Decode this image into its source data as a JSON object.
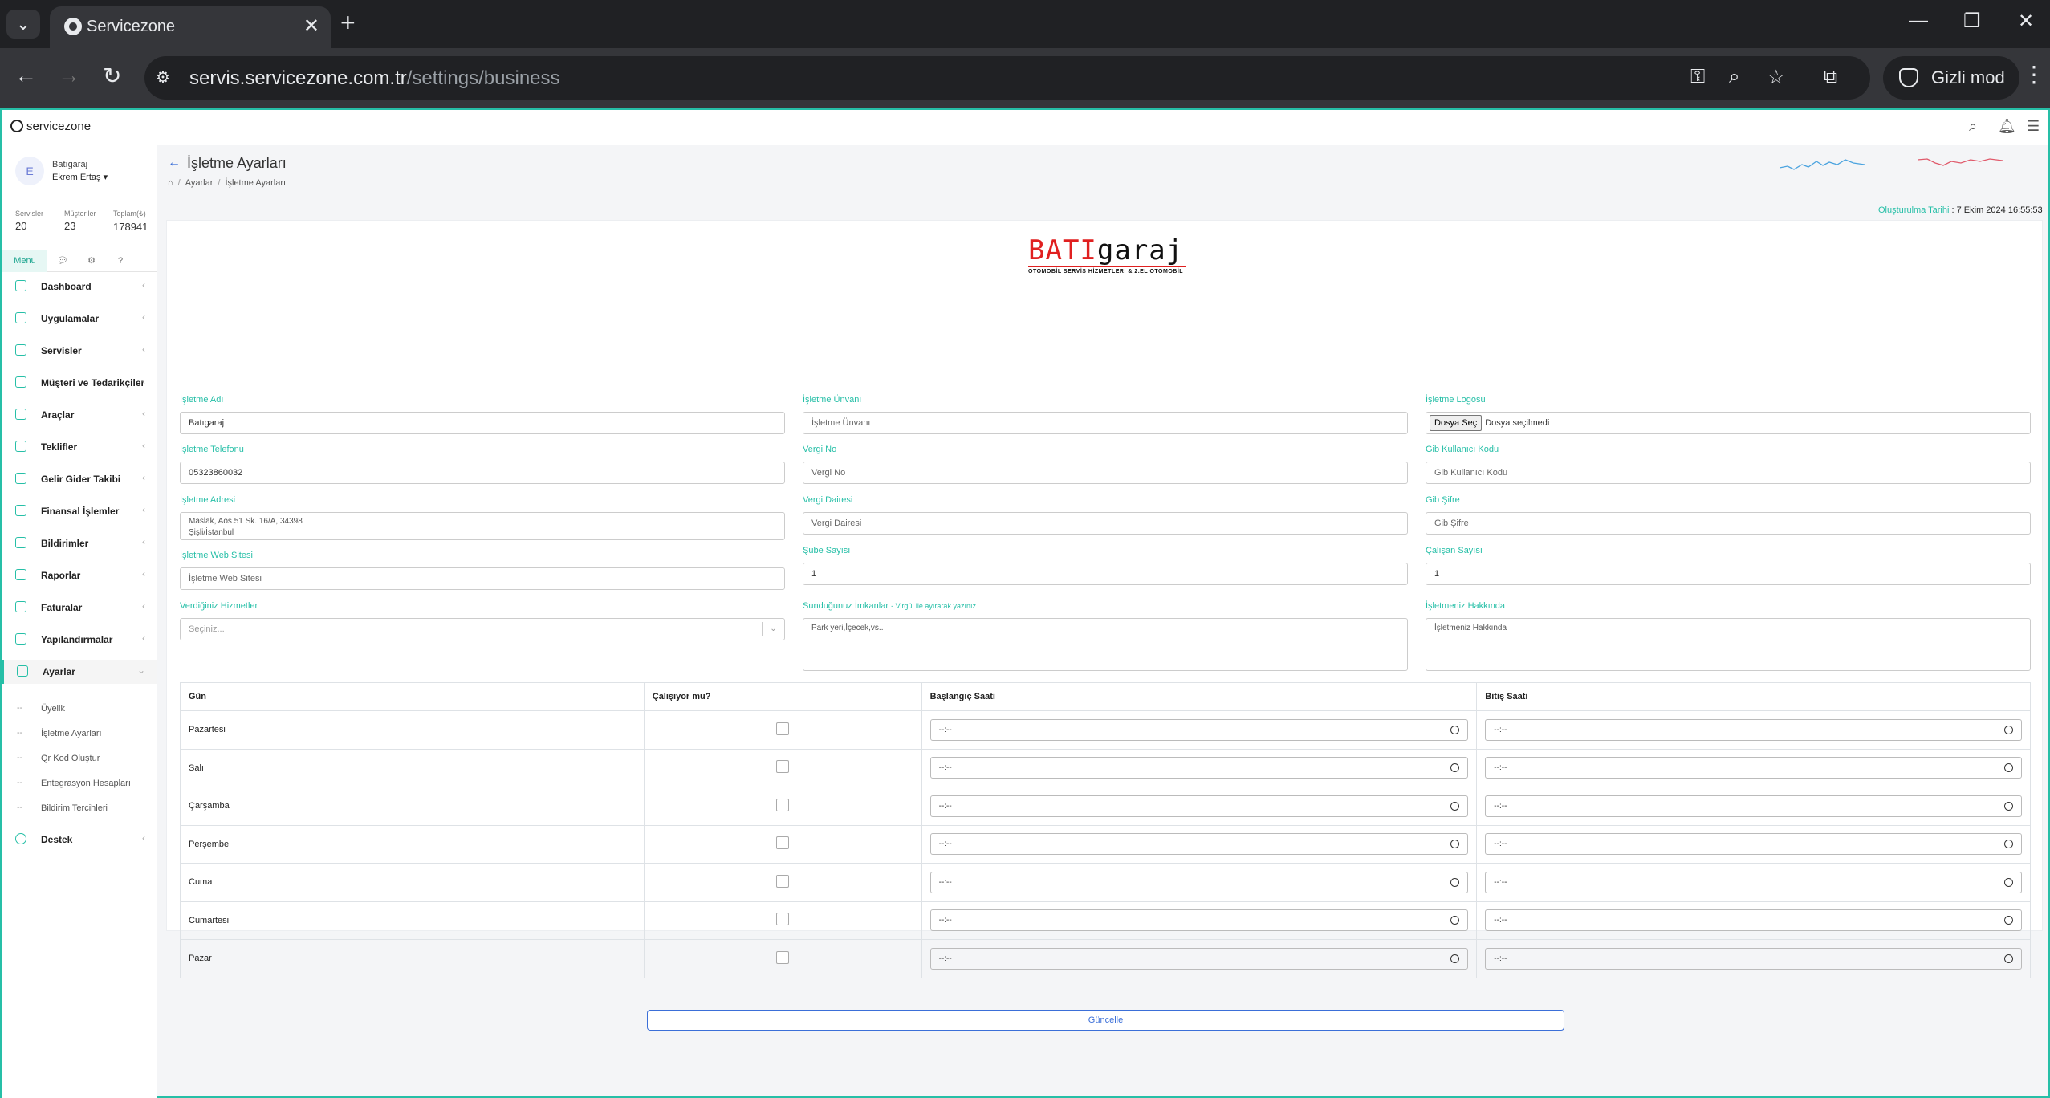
{
  "browser": {
    "tab_title": "Servicezone",
    "url_host": "servis.servicezone.com.tr",
    "url_path": "/settings/business",
    "incognito_label": "Gizli mod"
  },
  "app": {
    "brand": "servicezone"
  },
  "sidebar": {
    "avatar_initial": "E",
    "org_name": "Batıgaraj",
    "user_name": "Ekrem Ertaş ▾",
    "stats": [
      {
        "label": "Servisler",
        "value": "20"
      },
      {
        "label": "Müşteriler",
        "value": "23"
      },
      {
        "label": "Toplam(₺)",
        "value": "178941"
      }
    ],
    "tab_menu": "Menu",
    "menu": [
      "Dashboard",
      "Uygulamalar",
      "Servisler",
      "Müşteri ve Tedarikçiler",
      "Araçlar",
      "Teklifler",
      "Gelir Gider Takibi",
      "Finansal İşlemler",
      "Bildirimler",
      "Raporlar",
      "Faturalar",
      "Yapılandırmalar",
      "Ayarlar"
    ],
    "submenu": [
      "Üyelik",
      "İşletme Ayarları",
      "Qr Kod Oluştur",
      "Entegrasyon Hesapları",
      "Bildirim Tercihleri"
    ],
    "support": "Destek"
  },
  "page": {
    "title": "İşletme Ayarları",
    "breadcrumb": [
      "Ayarlar",
      "İşletme Ayarları"
    ],
    "created_label": "Oluşturulma Tarihi",
    "created_value": ": 7 Ekim 2024 16:55:53"
  },
  "logo": {
    "part_red": "BATI",
    "part_black": "garaj",
    "subtitle": "OTOMOBİL SERVİS HİZMETLERİ & 2.EL OTOMOBİL"
  },
  "form": {
    "business_name": {
      "label": "İşletme Adı",
      "value": "Batıgaraj"
    },
    "business_title": {
      "label": "İşletme Ünvanı",
      "placeholder": "İşletme Ünvanı"
    },
    "business_logo": {
      "label": "İşletme Logosu",
      "button": "Dosya Seç",
      "status": "Dosya seçilmedi"
    },
    "phone": {
      "label": "İşletme Telefonu",
      "value": "05323860032"
    },
    "tax_no": {
      "label": "Vergi No",
      "placeholder": "Vergi No"
    },
    "gib_user": {
      "label": "Gib Kullanıcı Kodu",
      "placeholder": "Gib Kullanıcı Kodu"
    },
    "address": {
      "label": "İşletme Adresi",
      "line1": "Maslak, Aos.51 Sk. 16/A, 34398",
      "line2": "Şişli/İstanbul"
    },
    "tax_office": {
      "label": "Vergi Dairesi",
      "placeholder": "Vergi Dairesi"
    },
    "gib_password": {
      "label": "Gib Şifre",
      "placeholder": "Gib Şifre"
    },
    "website": {
      "label": "İşletme Web Sitesi",
      "placeholder": "İşletme Web Sitesi"
    },
    "branch_count": {
      "label": "Şube Sayısı",
      "value": "1"
    },
    "employee_count": {
      "label": "Çalışan Sayısı",
      "value": "1"
    },
    "services": {
      "label": "Verdiğiniz Hizmetler",
      "placeholder": "Seçiniz..."
    },
    "amenities": {
      "label": "Sunduğunuz İmkanlar",
      "hint": "- Virgül ile ayırarak yazınız",
      "placeholder": "Park yeri,İçecek,vs.."
    },
    "about": {
      "label": "İşletmeniz Hakkında",
      "placeholder": "İşletmeniz Hakkında"
    }
  },
  "hours": {
    "headers": [
      "Gün",
      "Çalışıyor mu?",
      "Başlangıç Saati",
      "Bitiş Saati"
    ],
    "days": [
      "Pazartesi",
      "Salı",
      "Çarşamba",
      "Perşembe",
      "Cuma",
      "Cumartesi",
      "Pazar"
    ],
    "time_placeholder": "--:--"
  },
  "actions": {
    "update": "Güncelle"
  },
  "colors": {
    "accent": "#26bfa7",
    "primary": "#3b6fd8",
    "logo_red": "#e02020"
  }
}
